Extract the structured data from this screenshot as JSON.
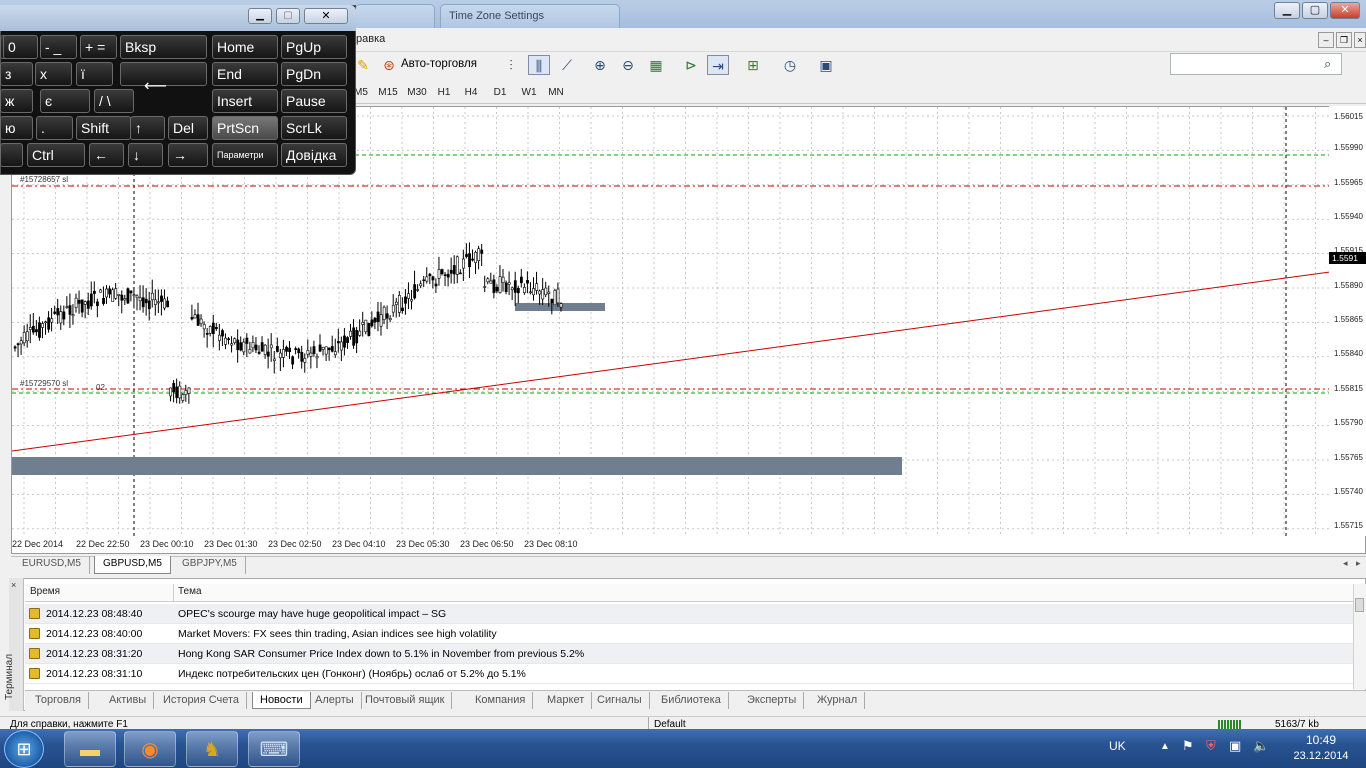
{
  "window": {
    "tabs": [
      "Time Zone Settings"
    ],
    "controls": {
      "min": "▁",
      "max": "▢",
      "close": "✕"
    }
  },
  "menubar": {
    "visible_item": "равка"
  },
  "toolbar": {
    "autotrade_label": "Авто-торговля"
  },
  "timeframes": [
    "M5",
    "M15",
    "M30",
    "H1",
    "H4",
    "D1",
    "W1",
    "MN"
  ],
  "search": {
    "placeholder": ""
  },
  "chart": {
    "tags": {
      "sl1": "#15728657 sl",
      "sl2": "#15729570 sl",
      "cursor_price": "02"
    },
    "current_price": "1.5591"
  },
  "chart_data": {
    "type": "line",
    "price_ticks": [
      "1.56015",
      "1.55990",
      "1.55965",
      "1.55940",
      "1.55915",
      "1.55890",
      "1.55865",
      "1.55840",
      "1.55815",
      "1.55790",
      "1.55765",
      "1.55740",
      "1.55715"
    ],
    "time_ticks": [
      "22 Dec 2014",
      "22 Dec 22:50",
      "23 Dec 00:10",
      "23 Dec 01:30",
      "23 Dec 02:50",
      "23 Dec 04:10",
      "23 Dec 05:30",
      "23 Dec 06:50",
      "23 Dec 08:10"
    ],
    "grid": true,
    "ylim": [
      1.55715,
      1.56015
    ]
  },
  "chart_tabs": {
    "items": [
      "EURUSD,M5",
      "GBPUSD,M5",
      "GBPJPY,M5"
    ],
    "active": 1
  },
  "terminal": {
    "side_label": "Терминал",
    "columns": {
      "time": "Время",
      "topic": "Тема"
    },
    "rows": [
      {
        "time": "2014.12.23 08:48:40",
        "topic": "OPEC's scourge may have huge geopolitical impact – SG"
      },
      {
        "time": "2014.12.23 08:40:00",
        "topic": "Market Movers: FX sees thin trading, Asian indices see high volatility"
      },
      {
        "time": "2014.12.23 08:31:20",
        "topic": "Hong Kong SAR Consumer Price Index down to 5.1% in November from previous 5.2%"
      },
      {
        "time": "2014.12.23 08:31:10",
        "topic": "Индекс потребительских цен (Гонконг) (Ноябрь) ослаб от 5.2% до 5.1%"
      }
    ],
    "tabs": [
      "Торговля",
      "Активы",
      "История Счета",
      "Новости",
      "Алерты",
      "Почтовый ящик",
      "Компания",
      "Маркет",
      "Сигналы",
      "Библиотека",
      "Эксперты",
      "Журнал"
    ],
    "active_tab": 3
  },
  "statusbar": {
    "help": "Для справки, нажмите F1",
    "profile": "Default",
    "traffic": "5163/7 kb"
  },
  "taskbar": {
    "lang": "UK",
    "time": "10:49",
    "date": "23.12.2014"
  },
  "osk": {
    "rows": [
      [
        ")",
        "0",
        "- _",
        "+ =",
        "Bksp",
        "Home",
        "PgUp"
      ],
      [
        "з",
        "х",
        "ї",
        "",
        "End",
        "PgDn"
      ],
      [
        "ж",
        "є",
        "/ \\",
        "Insert",
        "Pause"
      ],
      [
        "ю",
        ".",
        "Shift",
        "↑",
        "Del",
        "PrtScn",
        "ScrLk"
      ],
      [
        "",
        "Ctrl",
        "←",
        "↓",
        "→",
        "Параметри",
        "Довідка"
      ]
    ]
  },
  "colors": {
    "bull": "#000000",
    "trend": "#cc0000",
    "sl": "#cc0000",
    "tp": "#00aa00",
    "box": "#6f7f8f"
  }
}
